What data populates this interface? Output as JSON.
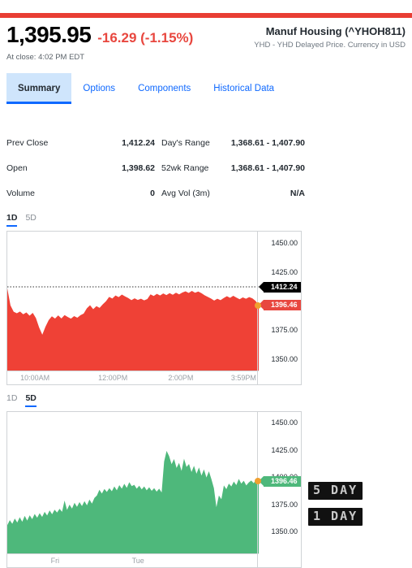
{
  "accent": {
    "top_rule": "#e83e34",
    "down_red": "#e8473f",
    "up_green": "#4eb87b",
    "link_blue": "#0f69ff",
    "tab_active_bg": "#cfe5fc",
    "marker_dot": "#f0a030",
    "prev_close_black": "#000000"
  },
  "header": {
    "price": "1,395.95",
    "change": "-16.29 (-1.15%)",
    "market_time": "At close: 4:02 PM EDT",
    "security_name": "Manuf Housing (^YHOH811)",
    "security_sub": "YHD - YHD Delayed Price. Currency in USD"
  },
  "tabs": [
    {
      "label": "Summary",
      "active": true
    },
    {
      "label": "Options",
      "active": false
    },
    {
      "label": "Components",
      "active": false
    },
    {
      "label": "Historical Data",
      "active": false
    }
  ],
  "stats": [
    {
      "left_label": "Prev Close",
      "left_value": "1,412.24",
      "right_label": "Day's Range",
      "right_value": "1,368.61 - 1,407.90"
    },
    {
      "left_label": "Open",
      "left_value": "1,398.62",
      "right_label": "52wk Range",
      "right_value": "1,368.61 - 1,407.90"
    },
    {
      "left_label": "Volume",
      "left_value": "0",
      "right_label": "Avg Vol (3m)",
      "right_value": "N/A"
    }
  ],
  "charts": [
    {
      "id": "chart-1d",
      "badge": "1 DAY",
      "range_tabs": [
        {
          "label": "1D",
          "active": true
        },
        {
          "label": "5D",
          "active": false
        }
      ],
      "markers": {
        "prev_close": "1412.24",
        "last_price": "1396.46"
      }
    },
    {
      "id": "chart-5d",
      "badge": "5 DAY",
      "range_tabs": [
        {
          "label": "1D",
          "active": false
        },
        {
          "label": "5D",
          "active": true
        }
      ],
      "markers": {
        "last_price": "1396.46"
      }
    }
  ],
  "chart_data": [
    {
      "type": "area",
      "id": "chart-1d",
      "title": "Manuf Housing (^YHOH811) — 1 Day",
      "color": "#ef4136",
      "direction": "down",
      "xlabel": "",
      "ylabel": "",
      "ylim": [
        1340,
        1460
      ],
      "yticks": [
        1450.0,
        1425.0,
        1375.0,
        1350.0
      ],
      "ytick_labels": [
        "1450.00",
        "1425.00",
        "1375.00",
        "1350.00"
      ],
      "xticks": [
        "10:00AM",
        "12:00PM",
        "2:00PM",
        "3:59PM"
      ],
      "xtick_positions_pct": [
        11,
        42,
        69,
        94
      ],
      "grid": false,
      "reference_line": {
        "value": 1412.24,
        "label": "1412.24",
        "style": "dotted",
        "color": "#333333"
      },
      "last_point": {
        "value": 1396.46,
        "label": "1396.46"
      },
      "x": [
        0,
        1,
        2,
        3,
        4,
        5,
        6,
        7,
        8,
        9,
        10,
        11,
        12,
        13,
        14,
        15,
        16,
        17,
        18,
        19,
        20,
        21,
        22,
        23,
        24,
        25,
        26,
        27,
        28,
        29,
        30,
        31,
        32,
        33,
        34,
        35,
        36,
        37,
        38,
        39,
        40,
        41,
        42,
        43,
        44,
        45,
        46,
        47,
        48,
        49,
        50,
        51,
        52,
        53,
        54,
        55,
        56,
        57,
        58,
        59,
        60,
        61,
        62,
        63,
        64,
        65,
        66,
        67,
        68,
        69,
        70,
        71,
        72,
        73,
        74,
        75,
        76,
        77,
        78,
        79
      ],
      "values": [
        1411.0,
        1396.2,
        1390.8,
        1389.5,
        1391.0,
        1388.6,
        1390.2,
        1387.4,
        1389.8,
        1385.3,
        1377.2,
        1371.0,
        1377.9,
        1383.5,
        1386.8,
        1384.9,
        1387.6,
        1385.0,
        1387.9,
        1386.2,
        1384.8,
        1387.0,
        1385.6,
        1387.8,
        1389.2,
        1393.8,
        1396.4,
        1393.0,
        1395.6,
        1394.1,
        1397.2,
        1399.8,
        1403.6,
        1402.2,
        1404.8,
        1403.4,
        1405.6,
        1404.0,
        1402.6,
        1400.8,
        1402.4,
        1401.0,
        1402.0,
        1400.6,
        1401.8,
        1405.8,
        1404.4,
        1406.2,
        1404.8,
        1406.6,
        1405.2,
        1406.8,
        1405.4,
        1407.2,
        1405.8,
        1407.4,
        1408.4,
        1407.0,
        1408.8,
        1407.2,
        1408.2,
        1406.8,
        1405.0,
        1403.6,
        1402.2,
        1400.4,
        1402.0,
        1400.8,
        1402.6,
        1404.2,
        1402.8,
        1404.6,
        1403.0,
        1401.6,
        1403.2,
        1402.0,
        1403.4,
        1402.4,
        1400.2,
        1396.46
      ]
    },
    {
      "type": "area",
      "id": "chart-5d",
      "title": "Manuf Housing (^YHOH811) — 5 Day",
      "color": "#4eb87b",
      "direction": "up",
      "xlabel": "",
      "ylabel": "",
      "ylim": [
        1330,
        1460
      ],
      "yticks": [
        1450.0,
        1425.0,
        1400.0,
        1375.0,
        1350.0
      ],
      "ytick_labels": [
        "1450.00",
        "1425.00",
        "1400.00",
        "1375.00",
        "1350.00"
      ],
      "xticks": [
        "Fri",
        "Tue"
      ],
      "xtick_positions_pct": [
        19,
        52
      ],
      "grid": false,
      "last_point": {
        "value": 1396.46,
        "label": "1396.46"
      },
      "x": [
        0,
        1,
        2,
        3,
        4,
        5,
        6,
        7,
        8,
        9,
        10,
        11,
        12,
        13,
        14,
        15,
        16,
        17,
        18,
        19,
        20,
        21,
        22,
        23,
        24,
        25,
        26,
        27,
        28,
        29,
        30,
        31,
        32,
        33,
        34,
        35,
        36,
        37,
        38,
        39,
        40,
        41,
        42,
        43,
        44,
        45,
        46,
        47,
        48,
        49,
        50,
        51,
        52,
        53,
        54,
        55,
        56,
        57,
        58,
        59,
        60,
        61,
        62,
        63,
        64,
        65,
        66,
        67,
        68,
        69,
        70,
        71,
        72,
        73,
        74,
        75,
        76,
        77,
        78,
        79,
        80,
        81,
        82,
        83,
        84,
        85,
        86,
        87,
        88,
        89,
        90,
        91,
        92,
        93,
        94,
        95,
        96,
        97,
        98,
        99
      ],
      "values": [
        1356.0,
        1360.5,
        1357.2,
        1362.0,
        1358.4,
        1363.2,
        1359.0,
        1364.5,
        1360.2,
        1365.0,
        1361.5,
        1366.2,
        1362.8,
        1367.0,
        1363.5,
        1368.2,
        1364.8,
        1369.5,
        1366.0,
        1370.2,
        1367.5,
        1371.0,
        1368.2,
        1378.6,
        1370.0,
        1374.8,
        1371.2,
        1376.5,
        1372.8,
        1377.2,
        1373.5,
        1378.0,
        1374.2,
        1379.5,
        1375.8,
        1381.0,
        1383.2,
        1388.5,
        1385.0,
        1389.2,
        1386.5,
        1390.0,
        1387.2,
        1391.5,
        1388.0,
        1392.8,
        1389.5,
        1394.0,
        1390.2,
        1395.5,
        1391.8,
        1393.0,
        1389.5,
        1392.2,
        1388.8,
        1391.5,
        1388.0,
        1390.8,
        1387.5,
        1390.0,
        1386.8,
        1389.5,
        1386.0,
        1414.5,
        1424.2,
        1419.5,
        1412.0,
        1416.8,
        1408.5,
        1413.2,
        1405.8,
        1417.0,
        1409.5,
        1412.2,
        1404.8,
        1410.5,
        1403.2,
        1409.0,
        1401.5,
        1407.2,
        1399.8,
        1405.5,
        1398.2,
        1390.0,
        1372.5,
        1383.2,
        1379.8,
        1392.5,
        1389.0,
        1394.2,
        1391.5,
        1396.0,
        1392.8,
        1398.5,
        1394.2,
        1396.8,
        1392.5,
        1395.2,
        1397.0,
        1394.5,
        1398.2,
        1396.46
      ]
    }
  ]
}
